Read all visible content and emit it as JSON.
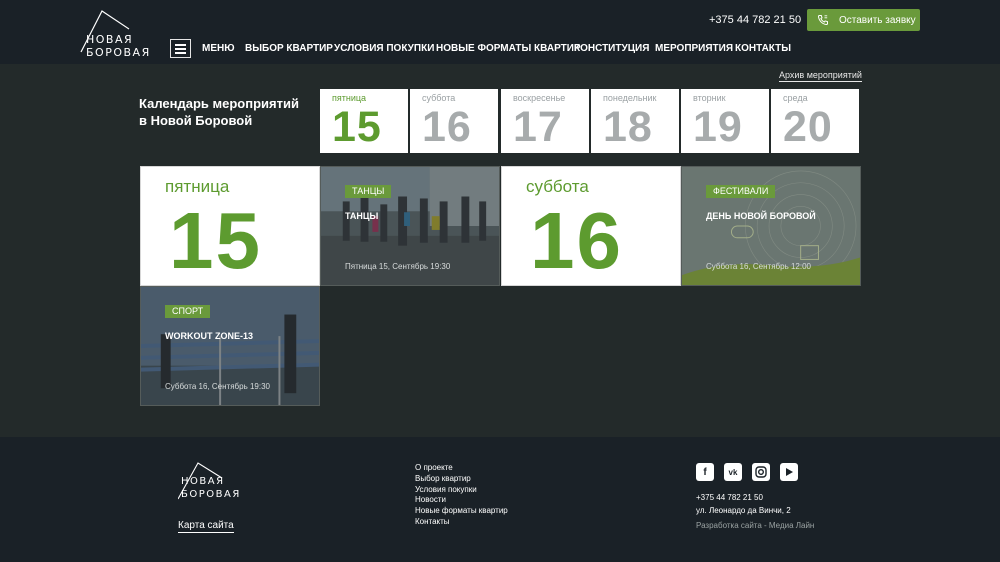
{
  "header": {
    "logo": {
      "line1": "НОВАЯ",
      "line2": "БОРОВАЯ"
    },
    "phone": "+375 44 782 21 50",
    "cta_label": "Оставить заявку",
    "menu_label": "МЕНЮ",
    "nav": [
      "ВЫБОР КВАРТИР",
      "УСЛОВИЯ ПОКУПКИ",
      "НОВЫЕ ФОРМАТЫ КВАРТИР",
      "КОНСТИТУЦИЯ",
      "МЕРОПРИЯТИЯ",
      "КОНТАКТЫ"
    ]
  },
  "calendar": {
    "archive_link": "Архив мероприятий",
    "title_line1": "Календарь мероприятий",
    "title_line2": "в Новой Боровой",
    "days": [
      {
        "name": "пятница",
        "date": "15",
        "active": true
      },
      {
        "name": "суббота",
        "date": "16",
        "active": false
      },
      {
        "name": "воскресенье",
        "date": "17",
        "active": false
      },
      {
        "name": "понедельник",
        "date": "18",
        "active": false
      },
      {
        "name": "вторник",
        "date": "19",
        "active": false
      },
      {
        "name": "среда",
        "date": "20",
        "active": false
      }
    ]
  },
  "tiles": {
    "fri": {
      "weekday": "пятница",
      "date": "15"
    },
    "sat": {
      "weekday": "суббота",
      "date": "16"
    },
    "events": [
      {
        "tag": "ТАНЦЫ",
        "title": "ТАНЦЫ",
        "datetime": "Пятница 15, Сентябрь 19:30"
      },
      {
        "tag": "ФЕСТИВАЛИ",
        "title": "ДЕНЬ НОВОЙ БОРОВОЙ",
        "datetime": "Суббота 16, Сентябрь 12:00"
      },
      {
        "tag": "СПОРТ",
        "title": "WORKOUT ZONE-13",
        "datetime": "Суббота 16, Сентябрь 19:30"
      }
    ]
  },
  "footer": {
    "logo": {
      "line1": "НОВАЯ",
      "line2": "БОРОВАЯ"
    },
    "sitemap_link": "Карта сайта",
    "links": [
      "О проекте",
      "Выбор квартир",
      "Условия покупки",
      "Новости",
      "Новые форматы квартир",
      "Контакты"
    ],
    "social": [
      "facebook-icon",
      "vk-icon",
      "instagram-icon",
      "youtube-icon"
    ],
    "phone": "+375 44 782 21 50",
    "address": "ул. Леонардо да Винчи, 2",
    "developer": "Разработка сайта - Медиа Лайн"
  },
  "colors": {
    "accent": "#6a9a3b",
    "date_green": "#5d9b2f",
    "header_bg": "#1a2127",
    "page_bg": "#232a2a"
  }
}
